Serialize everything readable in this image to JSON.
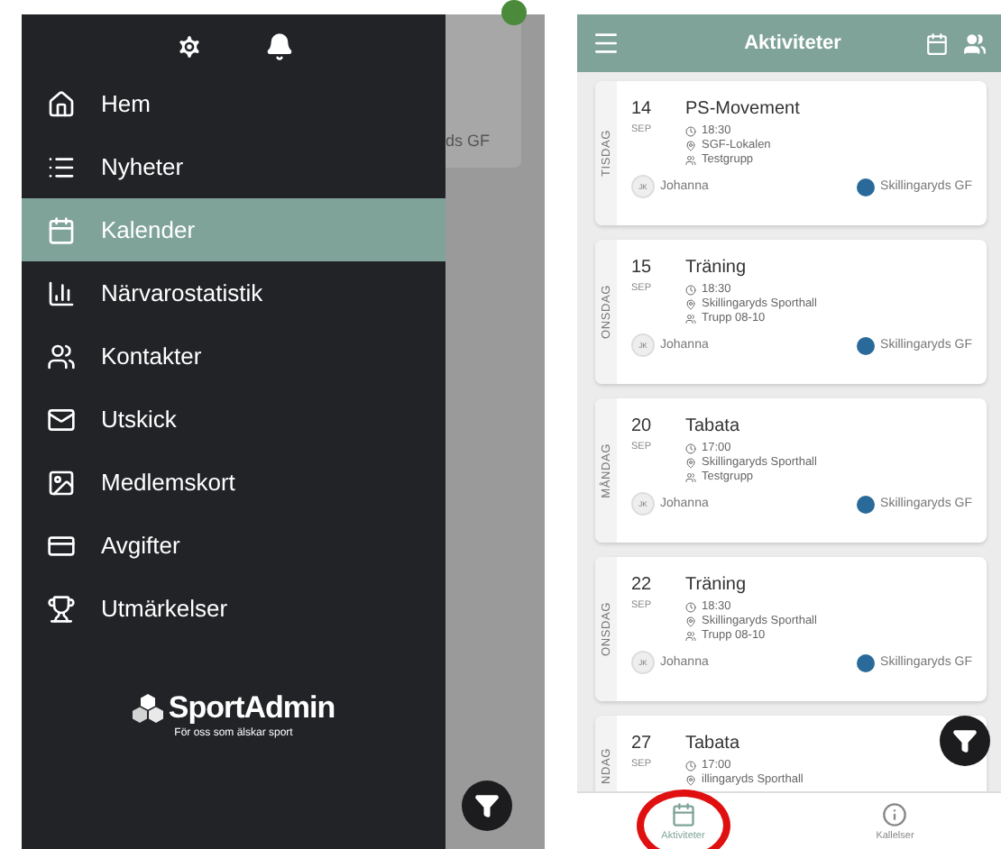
{
  "drawer": {
    "menu": [
      {
        "label": "Hem",
        "selected": false
      },
      {
        "label": "Nyheter",
        "selected": false
      },
      {
        "label": "Kalender",
        "selected": true
      },
      {
        "label": "Närvarostatistik",
        "selected": false
      },
      {
        "label": "Kontakter",
        "selected": false
      },
      {
        "label": "Utskick",
        "selected": false
      },
      {
        "label": "Medlemskort",
        "selected": false
      },
      {
        "label": "Avgifter",
        "selected": false
      },
      {
        "label": "Utmärkelser",
        "selected": false
      }
    ],
    "logo": {
      "name": "SportAdmin",
      "tagline": "För oss som älskar sport"
    },
    "background_card_text": "ds GF"
  },
  "activities": {
    "title": "Aktiviteter",
    "events": [
      {
        "weekday": "TISDAG",
        "day": "14",
        "month": "SEP",
        "title": "PS-Movement",
        "time": "18:30",
        "location": "SGF-Lokalen",
        "group": "Testgrupp",
        "leader_initials": "JK",
        "leader": "Johanna",
        "club": "Skillingaryds GF"
      },
      {
        "weekday": "ONSDAG",
        "day": "15",
        "month": "SEP",
        "title": "Träning",
        "time": "18:30",
        "location": "Skillingaryds Sporthall",
        "group": "Trupp 08-10",
        "leader_initials": "JK",
        "leader": "Johanna",
        "club": "Skillingaryds GF"
      },
      {
        "weekday": "MÅNDAG",
        "day": "20",
        "month": "SEP",
        "title": "Tabata",
        "time": "17:00",
        "location": "Skillingaryds Sporthall",
        "group": "Testgrupp",
        "leader_initials": "JK",
        "leader": "Johanna",
        "club": "Skillingaryds GF"
      },
      {
        "weekday": "ONSDAG",
        "day": "22",
        "month": "SEP",
        "title": "Träning",
        "time": "18:30",
        "location": "Skillingaryds Sporthall",
        "group": "Trupp 08-10",
        "leader_initials": "JK",
        "leader": "Johanna",
        "club": "Skillingaryds GF"
      },
      {
        "weekday": "NDAG",
        "day": "27",
        "month": "SEP",
        "title": "Tabata",
        "time": "17:00",
        "location": "illingaryds Sporthall"
      }
    ],
    "tabs": [
      {
        "label": "Aktiviteter",
        "selected": true,
        "circled": true
      },
      {
        "label": "Kallelser",
        "selected": false,
        "circled": false
      }
    ]
  }
}
